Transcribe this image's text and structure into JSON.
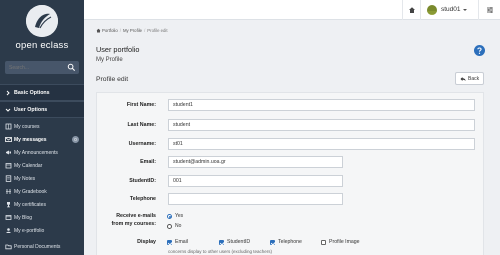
{
  "brand": {
    "logo_text": "open eclass"
  },
  "search": {
    "placeholder": "Search..."
  },
  "sidebar": {
    "sections": [
      {
        "label": "Basic Options"
      },
      {
        "label": "User Options"
      }
    ],
    "items": [
      {
        "label": "My courses",
        "icon": "book-icon"
      },
      {
        "label": "My messages",
        "icon": "envelope-icon",
        "badge": "0"
      },
      {
        "label": "My Announcements",
        "icon": "bullhorn-icon"
      },
      {
        "label": "My Calendar",
        "icon": "calendar-icon"
      },
      {
        "label": "My Notes",
        "icon": "notes-icon"
      },
      {
        "label": "My Gradebook",
        "icon": "gradebook-icon"
      },
      {
        "label": "My certificates",
        "icon": "trophy-icon"
      },
      {
        "label": "My Blog",
        "icon": "blog-icon"
      },
      {
        "label": "My e-portfolio",
        "icon": "portfolio-icon"
      },
      {
        "label": "Personal Documents",
        "icon": "folder-icon"
      }
    ]
  },
  "topbar": {
    "user_name": "stud01"
  },
  "breadcrumb": [
    "Portfolio",
    "My Profile",
    "Profile edit"
  ],
  "header": {
    "title": "User portfolio",
    "subtitle": "My Profile",
    "section_title": "Profile edit",
    "back_label": "Back"
  },
  "form": {
    "first_name": {
      "label": "First Name:",
      "value": "student1"
    },
    "last_name": {
      "label": "Last Name:",
      "value": "student"
    },
    "username": {
      "label": "Username:",
      "value": "st01"
    },
    "email": {
      "label": "Email:",
      "value": "student@admin.uoa.gr"
    },
    "student_id": {
      "label": "StudentID:",
      "value": "001"
    },
    "telephone": {
      "label": "Telephone",
      "value": ""
    },
    "receive_emails": {
      "label_line1": "Receive e-mails",
      "label_line2": "from my courses:",
      "options": [
        {
          "label": "Yes",
          "selected": true
        },
        {
          "label": "No",
          "selected": false
        }
      ]
    },
    "display": {
      "label": "Display",
      "options": [
        {
          "label": "Email",
          "checked": true
        },
        {
          "label": "StudentID",
          "checked": true
        },
        {
          "label": "Telephone",
          "checked": true
        },
        {
          "label": "Profile Image",
          "checked": false
        }
      ],
      "hint": "concerns display to other users (excluding teachers)"
    }
  },
  "colors": {
    "sidebar_bg": "#2c3a4a",
    "accent": "#2c6fbb"
  }
}
